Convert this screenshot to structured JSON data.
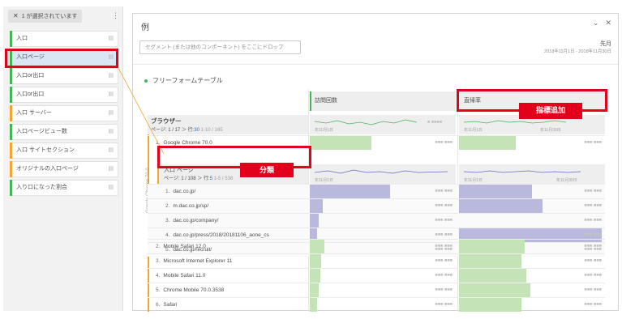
{
  "left_rail": {
    "selection_chip": "1 が選択されています",
    "components": [
      {
        "label": "入口",
        "color": "#44b556",
        "selected": false
      },
      {
        "label": "入口ページ",
        "color": "#44b556",
        "selected": true
      },
      {
        "label": "入口or出口",
        "color": "#44b556",
        "selected": false
      },
      {
        "label": "入口or出口",
        "color": "#44b556",
        "selected": false
      },
      {
        "label": "入口 サーバー",
        "color": "#f3a533",
        "selected": false
      },
      {
        "label": "入口ページビュー数",
        "color": "#44b556",
        "selected": false
      },
      {
        "label": "入口 サイトセクション",
        "color": "#f3a533",
        "selected": false
      },
      {
        "label": "オリジナルの入口ページ",
        "color": "#f3a533",
        "selected": false
      },
      {
        "label": "入り口になった割合",
        "color": "#44b556",
        "selected": false
      }
    ]
  },
  "panel": {
    "title": "例",
    "segment_dropzone": "セグメント (または他のコンポーネント) をここにドロップ",
    "date_label": "先月",
    "date_range": "2018年11月1日 - 2018年11月30日"
  },
  "table": {
    "title": "フリーフォームテーブル",
    "metric_headers": [
      "訪問回数",
      "直帰率"
    ],
    "dimension_title": "ブラウザー",
    "dimension_paging": {
      "prefix": "ページ: 1 / 17 ＞ 行:",
      "rows": "30",
      "range": "1-10 / 165"
    },
    "spark_start": "年11月1日",
    "spark_end": "年11月30日",
    "browser_rows": [
      {
        "num": "1.",
        "label": "Google Chrome 70.0",
        "visits": 0.42,
        "bounce": 0.39
      },
      {
        "num": "2.",
        "label": "Mobile Safari 12.0",
        "visits": 0.1,
        "bounce": 0.45
      },
      {
        "num": "3.",
        "label": "Microsoft Internet Explorer 11",
        "visits": 0.08,
        "bounce": 0.43
      },
      {
        "num": "4.",
        "label": "Mobile Safari 11.0",
        "visits": 0.07,
        "bounce": 0.46
      },
      {
        "num": "5.",
        "label": "Chrome Mobile 70.0.3538",
        "visits": 0.06,
        "bounce": 0.49
      },
      {
        "num": "6.",
        "label": "Safari",
        "visits": 0.05,
        "bounce": 0.43
      }
    ],
    "breakdown": {
      "vertical_label": "Google Chrome 70.0",
      "title": "入口 ページ",
      "paging": {
        "prefix": "ページ: 1 / 108 ＞ 行:",
        "rows": "5",
        "range": "1-5 / 538"
      },
      "rows": [
        {
          "num": "1.",
          "label": "dac.co.jp/",
          "visits": 0.55,
          "bounce": 0.5
        },
        {
          "num": "2.",
          "label": "m.dac.co.jp/sp/",
          "visits": 0.09,
          "bounce": 0.57
        },
        {
          "num": "3.",
          "label": "dac.co.jp/company/",
          "visits": 0.06,
          "bounce": 0.0
        },
        {
          "num": "4.",
          "label": "dac.co.jp/press/2018/20181106_aone_cs",
          "visits": 0.05,
          "bounce": 0.98
        },
        {
          "num": "5.",
          "label": "dac.co.jp/recruit/",
          "visits": 0.04,
          "bounce": 0.0
        }
      ]
    }
  },
  "annotations": {
    "breakdown_tag": "分類",
    "metric_tag": "指標追加"
  },
  "colors": {
    "accent_red": "#e3001b",
    "metric_green": "#44b556",
    "dimension_orange": "#f3a533",
    "bar_green": "#c4e3b7",
    "bar_purple": "#b8b9dd",
    "link_blue": "#1473e6"
  }
}
